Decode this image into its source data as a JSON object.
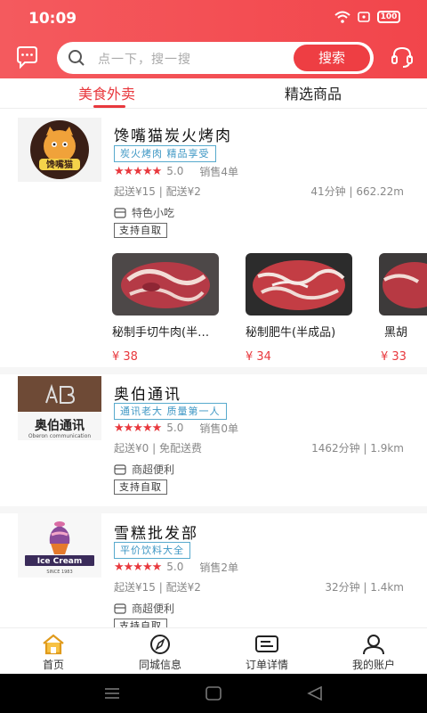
{
  "status": {
    "time": "10:09",
    "battery": "100"
  },
  "search": {
    "placeholder": "点一下，搜一搜",
    "button": "搜索"
  },
  "tabs": [
    {
      "label": "美食外卖",
      "active": true
    },
    {
      "label": "精选商品",
      "active": false
    }
  ],
  "shops": [
    {
      "name": "馋嘴猫炭火烤肉",
      "tag": "炭火烤肉 精品享受",
      "rating": "5.0",
      "sales": "销售4单",
      "delivery": "起送¥15 | 配送¥2",
      "distance": "41分钟 | 662.22m",
      "category": "特色小吃",
      "pickup": "支持自取",
      "logo_text": "馋嘴猫",
      "products": [
        {
          "name": "秘制手切牛肉(半…",
          "price": "¥ 38"
        },
        {
          "name": "秘制肥牛(半成品)",
          "price": "¥ 34"
        },
        {
          "name": "黑胡",
          "price": "¥ 33"
        }
      ]
    },
    {
      "name": "奥伯通讯",
      "tag": "通讯老大 质量第一人",
      "rating": "5.0",
      "sales": "销售0单",
      "delivery": "起送¥0 | 免配送费",
      "distance": "1462分钟 | 1.9km",
      "category": "商超便利",
      "pickup": "支持自取",
      "logo_text": "奥伯通讯",
      "logo_subtext": "Oberon communication"
    },
    {
      "name": "雪糕批发部",
      "tag": "平价饮料大全",
      "rating": "5.0",
      "sales": "销售2单",
      "delivery": "起送¥15 | 配送¥2",
      "distance": "32分钟 | 1.4km",
      "category": "商超便利",
      "pickup": "支持自取",
      "logo_text": "Ice Cream",
      "logo_subtext": "SINCE 1983"
    }
  ],
  "tabbar": [
    {
      "label": "首页"
    },
    {
      "label": "同城信息"
    },
    {
      "label": "订单详情"
    },
    {
      "label": "我的账户"
    }
  ],
  "colors": {
    "accent": "#e8383d",
    "tag_blue": "#3e97c4"
  }
}
